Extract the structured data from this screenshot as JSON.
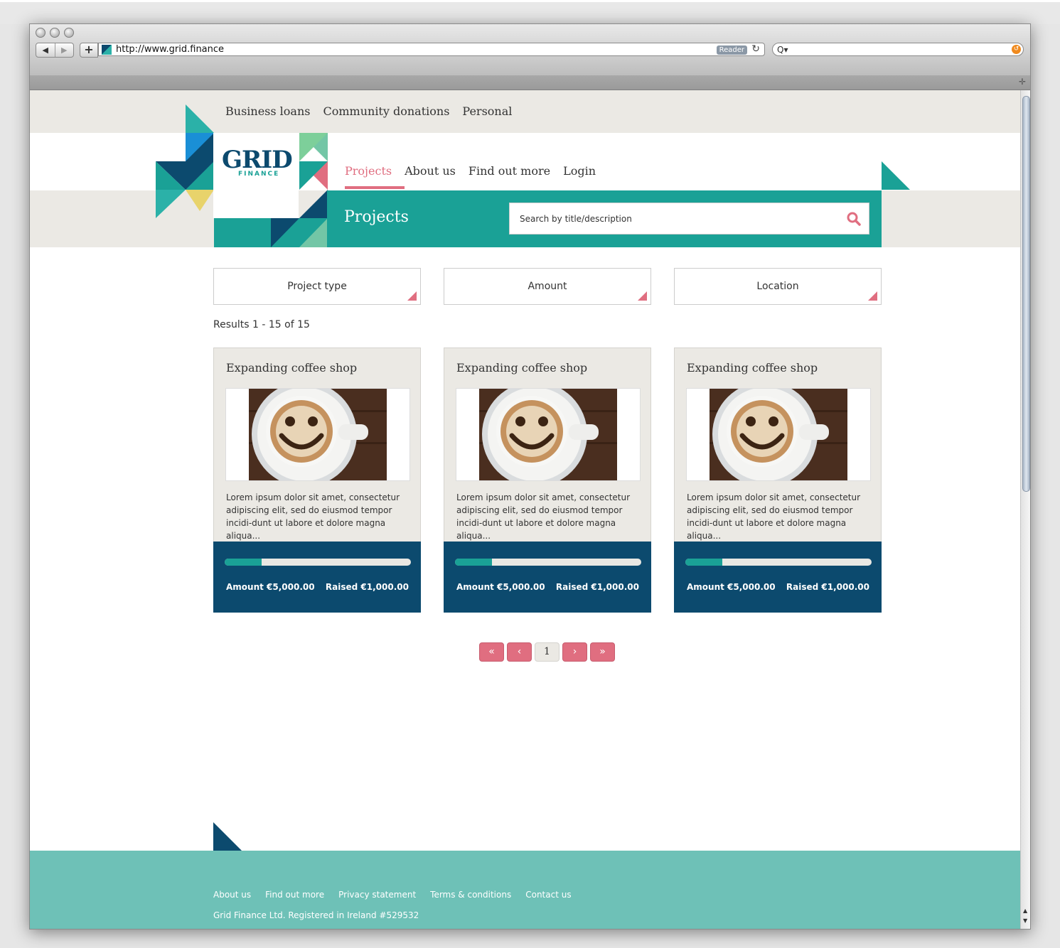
{
  "browser": {
    "url": "http://www.grid.finance",
    "reader_label": "Reader",
    "back_glyph": "◀",
    "forward_glyph": "▶",
    "add_glyph": "+",
    "reload_glyph": "↻",
    "search_glyph": "Q▾"
  },
  "site": {
    "top_links": [
      "Business loans",
      "Community donations",
      "Personal"
    ],
    "logo": {
      "name": "GRID",
      "sub": "FINANCE"
    },
    "main_nav": [
      "Projects",
      "About us",
      "Find out more",
      "Login"
    ],
    "active_nav": "Projects"
  },
  "banner": {
    "title": "Projects",
    "search_placeholder": "Search by title/description"
  },
  "filters": [
    "Project type",
    "Amount",
    "Location"
  ],
  "results_text": "Results 1 - 15 of 15",
  "cards": [
    {
      "title": "Expanding coffee shop",
      "description": "Lorem ipsum dolor sit amet, consectetur adipiscing elit, sed do eiusmod tempor incidi-dunt ut labore et dolore magna aliqua...",
      "amount": "Amount €5,000.00",
      "raised": "Raised €1,000.00",
      "progress": 0.2
    },
    {
      "title": "Expanding coffee shop",
      "description": "Lorem ipsum dolor sit amet, consectetur adipiscing elit, sed do eiusmod tempor incidi-dunt ut labore et dolore magna aliqua...",
      "amount": "Amount €5,000.00",
      "raised": "Raised €1,000.00",
      "progress": 0.2
    },
    {
      "title": "Expanding coffee shop",
      "description": "Lorem ipsum dolor sit amet, consectetur adipiscing elit, sed do eiusmod tempor incidi-dunt ut labore et dolore magna aliqua...",
      "amount": "Amount €5,000.00",
      "raised": "Raised €1,000.00",
      "progress": 0.2
    }
  ],
  "pagination": {
    "first": "«",
    "prev": "‹",
    "current": "1",
    "next": "›",
    "last": "»"
  },
  "footer": {
    "links": [
      "About us",
      "Find out more",
      "Privacy statement",
      "Terms & conditions",
      "Contact us"
    ],
    "copyright": "Grid Finance Ltd. Registered in Ireland #529532"
  },
  "colors": {
    "teal": "#1aa196",
    "navy": "#0c4a6e",
    "pink": "#e06e80",
    "footer": "#6ec1b7",
    "beige": "#ebe9e4"
  }
}
